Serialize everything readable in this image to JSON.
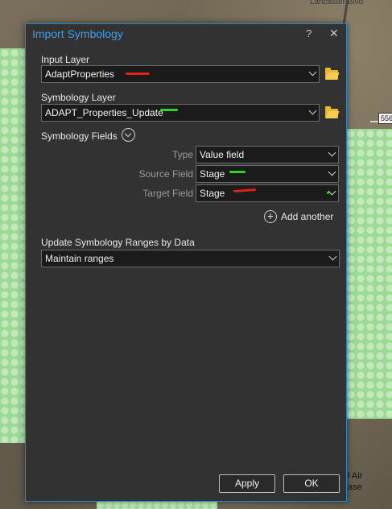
{
  "map": {
    "top_label": "Lancaster Blvd",
    "road_shield": "556",
    "airbase_label_line1": "l Air",
    "airbase_label_line2": "ase"
  },
  "dialog": {
    "title": "Import Symbology",
    "help_label": "?",
    "close_label": "✕",
    "input_layer": {
      "label": "Input Layer",
      "value": "AdaptProperties"
    },
    "symbology_layer": {
      "label": "Symbology Layer",
      "value": "ADAPT_Properties_Update"
    },
    "symbology_fields": {
      "label": "Symbology Fields",
      "type_label": "Type",
      "type_value": "Value field",
      "source_label": "Source Field",
      "source_value": "Stage",
      "target_label": "Target Field",
      "target_value": "Stage",
      "add_another": "Add another"
    },
    "ranges": {
      "label": "Update Symbology Ranges by Data",
      "value": "Maintain ranges"
    },
    "apply_label": "Apply",
    "ok_label": "OK"
  },
  "colors": {
    "accent": "#1e8ad6",
    "title": "#3aa0ee",
    "annotation_red": "#e0201c",
    "annotation_green": "#2bd61e",
    "folder": "#e8b735"
  },
  "icons": [
    "folder-icon",
    "chevron-down-icon",
    "plus-circle-icon",
    "close-icon",
    "help-icon"
  ]
}
